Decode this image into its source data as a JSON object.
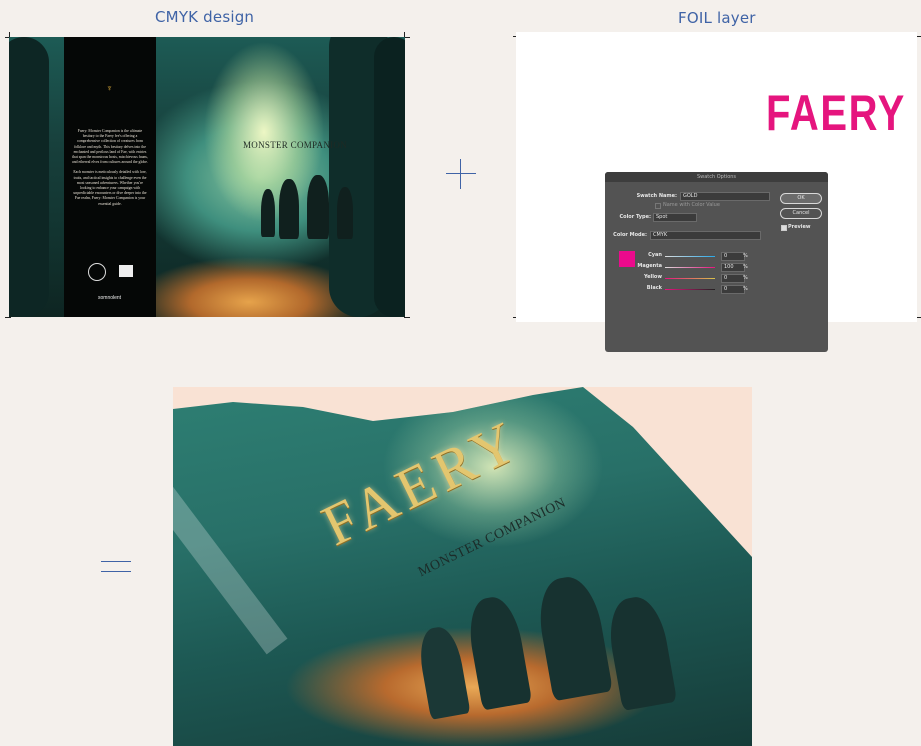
{
  "captions": {
    "cmyk": "CMYK design",
    "foil": "FOIL layer"
  },
  "cmyk_cover": {
    "title": "MONSTER COMPANION",
    "back_text": [
      "Faery: Monster Companion is the ultimate bestiary to the Faery fee's offering a comprehensive collection of creatures from folklore and myth. This bestiary delves into the enchanted and perilous land of Fae, with entries that span the monstrous hosts, mischievous fauns, and ethereal elves from cultures around the globe.",
      "Each monster is meticulously detailed with lore, traits, and tactical insights to challenge even the most seasoned adventurers. Whether you're looking to enhance your campaign with unpredictable encounters or dive deeper into the Fae realm, Faery: Monster Companion is your essential guide."
    ],
    "publisher": "somnolent"
  },
  "foil_layer": {
    "title": "FAERY"
  },
  "swatch_dialog": {
    "title": "Swatch Options",
    "swatch_name_label": "Swatch Name:",
    "swatch_name_value": "GOLD",
    "name_with_color_value": "Name with Color Value",
    "color_type_label": "Color Type:",
    "color_type_value": "Spot",
    "color_mode_label": "Color Mode:",
    "color_mode_value": "CMYK",
    "ok": "OK",
    "cancel": "Cancel",
    "preview": "Preview",
    "swatch_color": "#ec0a8c",
    "channels": [
      {
        "label": "Cyan",
        "value": "0",
        "unit": "%"
      },
      {
        "label": "Magenta",
        "value": "100",
        "unit": "%"
      },
      {
        "label": "Yellow",
        "value": "0",
        "unit": "%"
      },
      {
        "label": "Black",
        "value": "0",
        "unit": "%"
      }
    ]
  },
  "mockup": {
    "title": "FAERY",
    "subtitle": "MONSTER COMPANION"
  },
  "colors": {
    "accent": "#3f63a6",
    "foil_pink": "#e5157e",
    "background": "#f4f0ec"
  }
}
